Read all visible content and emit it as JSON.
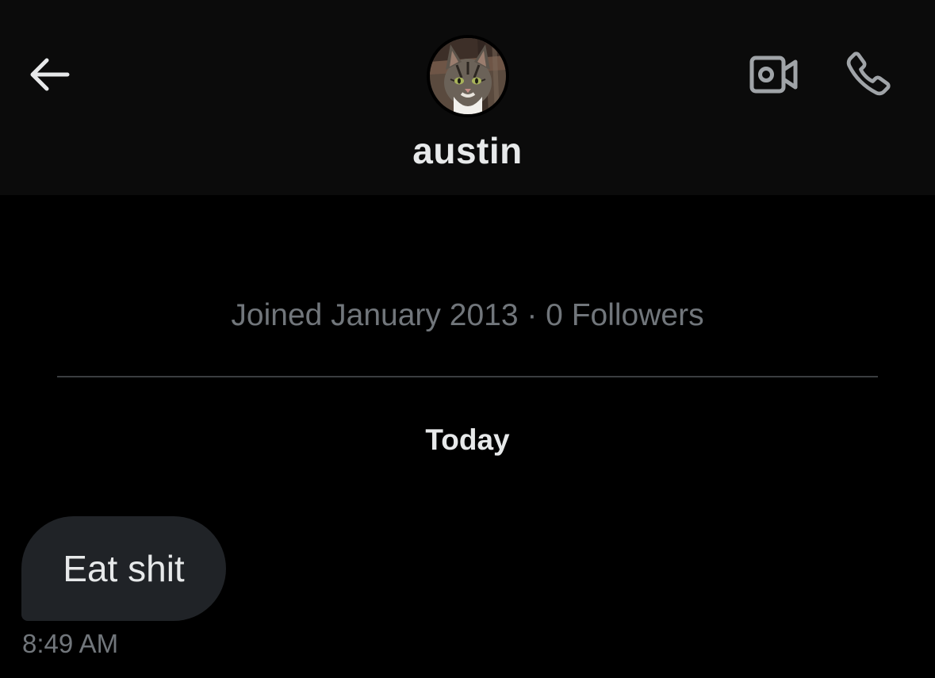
{
  "header": {
    "username": "austin",
    "avatar_icon": "cat-avatar",
    "back_icon": "arrow-left-icon",
    "video_icon": "video-camera-icon",
    "call_icon": "phone-icon"
  },
  "profile_meta": {
    "text": "Joined January 2013 · 0 Followers"
  },
  "conversation": {
    "day_label": "Today",
    "messages": [
      {
        "text": "Eat shit",
        "time": "8:49 AM",
        "direction": "incoming"
      }
    ]
  },
  "colors": {
    "background": "#000000",
    "header_background": "#0b0b0b",
    "primary_text": "#e7e9ea",
    "secondary_text": "#71767b",
    "bubble_incoming": "#202327",
    "divider": "#3a3d40"
  }
}
